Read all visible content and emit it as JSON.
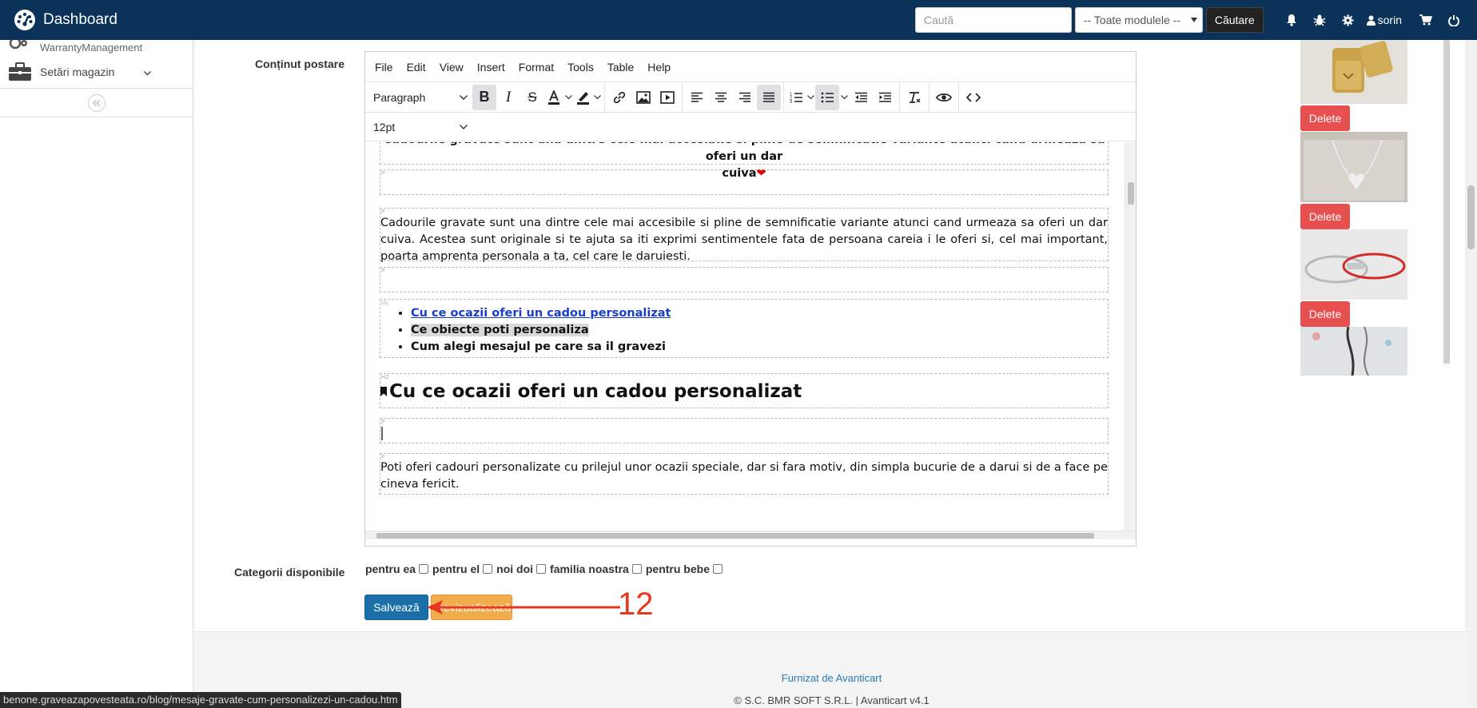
{
  "topnav": {
    "brand": "Dashboard",
    "search_placeholder": "Caută",
    "module_select": "-- Toate modulele --",
    "search_button": "Căutare",
    "user": "sorin"
  },
  "sidebar": {
    "items": [
      {
        "label": "WarrantyManagement"
      },
      {
        "label": "Setări magazin"
      }
    ]
  },
  "form": {
    "content_label": "Conținut postare",
    "categories_label": "Categorii disponibile",
    "categories": [
      "pentru ea",
      "pentru el",
      "noi doi",
      "familia noastra",
      "pentru bebe"
    ],
    "save_button": "Salvează",
    "preview_button": "Previzualizează"
  },
  "editor": {
    "menu": [
      "File",
      "Edit",
      "View",
      "Insert",
      "Format",
      "Tools",
      "Table",
      "Help"
    ],
    "block_format": "Paragraph",
    "font_size": "12pt",
    "content": {
      "top_line1": "Cadourile gravate sunt una dintre cele mai accesibile si pline de semnificatie variante atunci cand urmeaza sa oferi un dar",
      "top_line2": "cuiva",
      "heart": "❤",
      "paragraph1": "Cadourile gravate sunt una dintre cele mai accesibile si pline de semnificatie variante atunci cand urmeaza sa oferi un dar cuiva. Acestea sunt originale si te ajuta sa iti exprimi sentimentele fata de persoana careia i le oferi si, cel mai important, poarta amprenta personala a ta, cel care le daruiesti.",
      "bullets": [
        "Cu ce ocazii oferi un cadou personalizat",
        "Ce obiecte poti personaliza",
        "Cum alegi mesajul pe care sa il gravezi"
      ],
      "heading": "Cu ce ocazii oferi un cadou personalizat",
      "paragraph2": "Poti oferi cadouri personalizate cu prilejul unor ocazii speciale, dar si fara motiv, din simpla bucurie de a darui si de a face pe cineva fericit."
    }
  },
  "images": {
    "delete_label": "Delete"
  },
  "annotation": {
    "number": "12"
  },
  "footer": {
    "link": "Furnizat de Avanticart",
    "copyright": "© S.C. BMR SOFT S.R.L. | Avanticart v4.1"
  },
  "status_url": "benone.graveazapovesteata.ro/blog/mesaje-gravate-cum-personalizezi-un-cadou.htm",
  "colors": {
    "nav_bg": "#0b3359",
    "save": "#1a6fa8",
    "preview": "#f0ad4e",
    "delete": "#e84f4f",
    "link": "#1a3fc7",
    "annotation": "#e8371f"
  }
}
